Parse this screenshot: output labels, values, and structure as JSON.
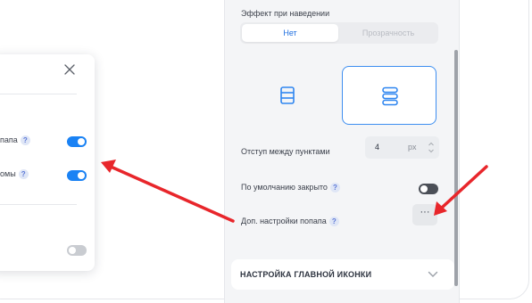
{
  "popup": {
    "close_icon": "close-icon",
    "rows": [
      {
        "label": "папа",
        "toggle": "on"
      },
      {
        "label": "омы",
        "toggle": "on"
      },
      {
        "label": "",
        "toggle": "off"
      }
    ],
    "help_glyph": "?"
  },
  "panel": {
    "hover_effect_label": "Эффект при наведении",
    "hover_options": [
      {
        "label": "Нет",
        "active": true
      },
      {
        "label": "Прозрачность",
        "active": false
      }
    ],
    "layout_options": [
      {
        "icon": "list-layout-icon",
        "selected": false
      },
      {
        "icon": "rounded-list-layout-icon",
        "selected": true
      }
    ],
    "item_spacing": {
      "label": "Отступ между пунктами",
      "value": "4",
      "unit": "px"
    },
    "closed_by_default": {
      "label": "По умолчанию закрыто",
      "toggle": "off"
    },
    "extra_popup_settings": {
      "label": "Доп. настройки попапа",
      "button": "···"
    },
    "main_icon_section": {
      "title": "НАСТРОЙКА ГЛАВНОЙ ИКОНКИ",
      "icon": "chevron-down-icon"
    }
  },
  "colors": {
    "accent": "#1a82f4",
    "arrow": "#e8262b",
    "panel_bg": "#f4f5f7"
  }
}
